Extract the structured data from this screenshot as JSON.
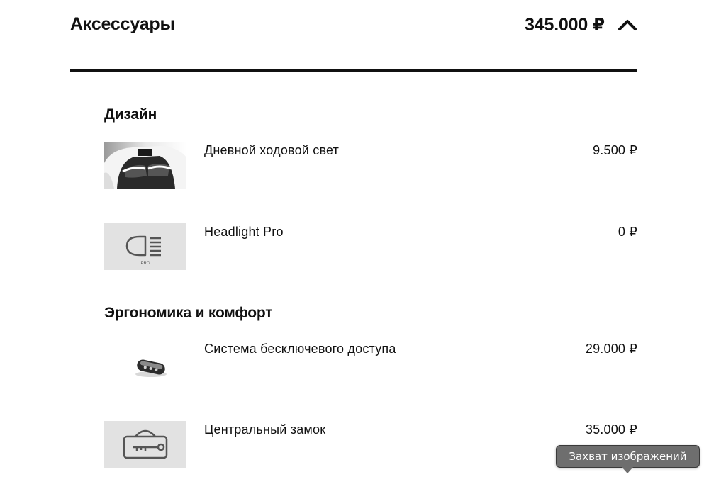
{
  "header": {
    "title": "Аксессуары",
    "total": "345.000 ₽",
    "collapse_icon": "chevron-up-icon"
  },
  "sections": [
    {
      "title": "Дизайн",
      "items": [
        {
          "name": "Дневной ходовой свет",
          "price": "9.500 ₽",
          "icon": "daytime-running-light-photo"
        },
        {
          "name": "Headlight Pro",
          "price": "0 ₽",
          "icon": "headlight-icon",
          "icon_caption": "PRO"
        }
      ]
    },
    {
      "title": "Эргономика и комфорт",
      "items": [
        {
          "name": "Система бесключевого доступа",
          "price": "29.000 ₽",
          "icon": "key-fob-photo"
        },
        {
          "name": "Центральный замок",
          "price": "35.000 ₽",
          "icon": "central-lock-icon"
        }
      ]
    }
  ],
  "tooltip": {
    "text": "Захват изображений"
  }
}
